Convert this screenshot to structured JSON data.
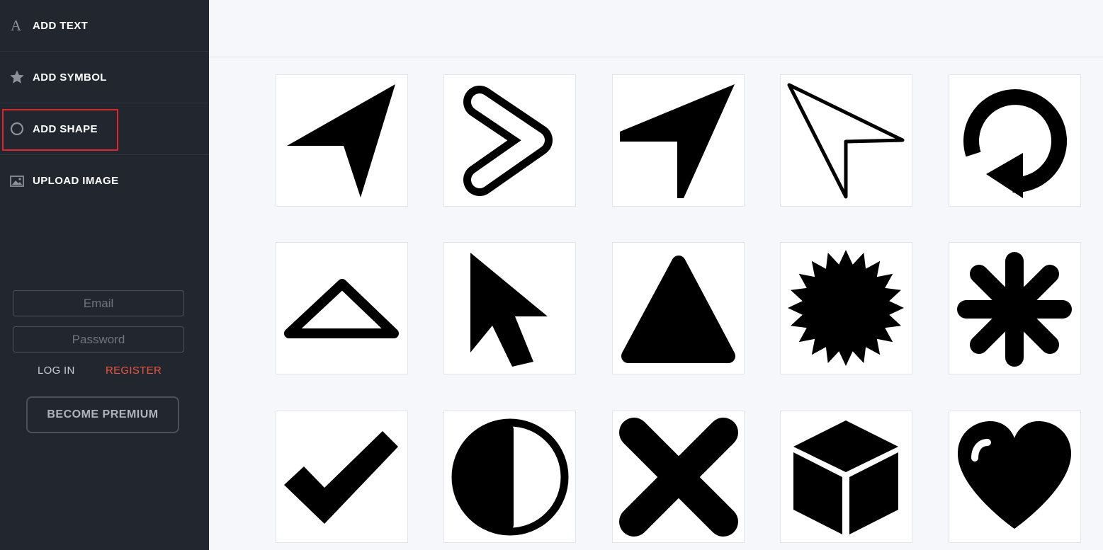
{
  "sidebar": {
    "menu": [
      {
        "label": "ADD TEXT",
        "icon": "letter-a-icon"
      },
      {
        "label": "ADD SYMBOL",
        "icon": "star-icon"
      },
      {
        "label": "ADD SHAPE",
        "icon": "circle-outline-icon",
        "selected": true
      },
      {
        "label": "UPLOAD IMAGE",
        "icon": "image-icon"
      }
    ],
    "login": {
      "email_placeholder": "Email",
      "password_placeholder": "Password",
      "login_label": "LOG IN",
      "register_label": "REGISTER",
      "premium_label": "BECOME PREMIUM"
    }
  },
  "shapes": [
    "navigation-arrow-shape",
    "chevron-right-outline-shape",
    "location-arrow-shape",
    "cursor-outline-shape",
    "refresh-arrow-shape",
    "triangle-outline-shape",
    "mouse-pointer-shape",
    "rounded-triangle-shape",
    "starburst-shape",
    "asterisk-shape",
    "checkmark-shape",
    "half-circle-contrast-shape",
    "x-cross-shape",
    "cube-shape",
    "heart-shape"
  ],
  "colors": {
    "sidebar_bg": "#22272f",
    "accent_register": "#e8573c",
    "highlight_border": "#e0262b",
    "canvas_bg": "#f5f7fa"
  }
}
